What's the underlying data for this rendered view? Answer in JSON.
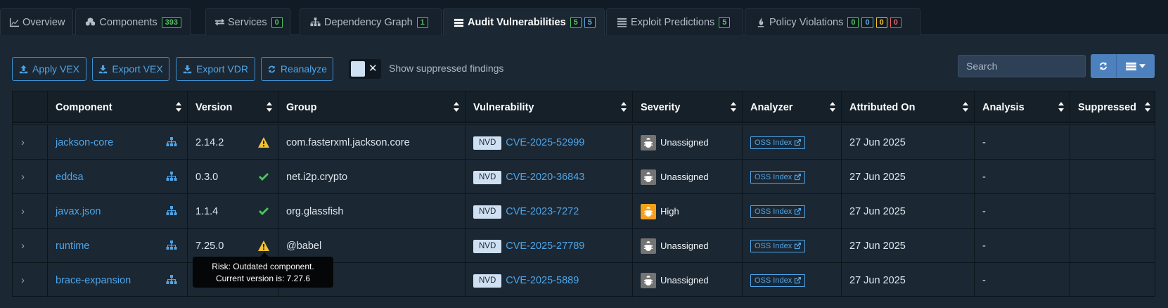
{
  "tabs": [
    {
      "label": "Overview",
      "icon": "line-chart-icon",
      "badges": []
    },
    {
      "label": "Components",
      "icon": "cubes-icon",
      "badges": [
        {
          "value": "393",
          "color": "green"
        }
      ]
    },
    {
      "label": "Services",
      "icon": "exchange-icon",
      "badges": [
        {
          "value": "0",
          "color": "green"
        }
      ]
    },
    {
      "label": "Dependency Graph",
      "icon": "sitemap-icon",
      "badges": [
        {
          "value": "1",
          "color": "green"
        }
      ]
    },
    {
      "label": "Audit Vulnerabilities",
      "icon": "tasks-icon",
      "active": true,
      "badges": [
        {
          "value": "5",
          "color": "green"
        },
        {
          "value": "5",
          "color": "blue"
        }
      ]
    },
    {
      "label": "Exploit Predictions",
      "icon": "list-icon",
      "badges": [
        {
          "value": "5",
          "color": "green"
        }
      ]
    },
    {
      "label": "Policy Violations",
      "icon": "fire-icon",
      "badges": [
        {
          "value": "0",
          "color": "green"
        },
        {
          "value": "0",
          "color": "blue"
        },
        {
          "value": "0",
          "color": "yellow"
        },
        {
          "value": "0",
          "color": "red"
        }
      ]
    }
  ],
  "toolbar": {
    "apply_vex": "Apply VEX",
    "export_vex": "Export VEX",
    "export_vdr": "Export VDR",
    "reanalyze": "Reanalyze",
    "toggle_x": "✕",
    "show_suppressed": "Show suppressed findings",
    "search_placeholder": "Search"
  },
  "columns": [
    "Component",
    "Version",
    "Group",
    "Vulnerability",
    "Severity",
    "Analyzer",
    "Attributed On",
    "Analysis",
    "Suppressed"
  ],
  "rows": [
    {
      "component": "jackson-core",
      "version": "2.14.2",
      "version_status": "warning",
      "group": "com.fasterxml.jackson.core",
      "source": "NVD",
      "vuln": "CVE-2025-52999",
      "severity": "Unassigned",
      "analyzer": "OSS Index",
      "attributed": "27 Jun 2025",
      "analysis": "-",
      "suppressed": ""
    },
    {
      "component": "eddsa",
      "version": "0.3.0",
      "version_status": "ok",
      "group": "net.i2p.crypto",
      "source": "NVD",
      "vuln": "CVE-2020-36843",
      "severity": "Unassigned",
      "analyzer": "OSS Index",
      "attributed": "27 Jun 2025",
      "analysis": "-",
      "suppressed": ""
    },
    {
      "component": "javax.json",
      "version": "1.1.4",
      "version_status": "ok",
      "group": "org.glassfish",
      "source": "NVD",
      "vuln": "CVE-2023-7272",
      "severity": "High",
      "analyzer": "OSS Index",
      "attributed": "27 Jun 2025",
      "analysis": "-",
      "suppressed": ""
    },
    {
      "component": "runtime",
      "version": "7.25.0",
      "version_status": "warning",
      "group": "@babel",
      "source": "NVD",
      "vuln": "CVE-2025-27789",
      "severity": "Unassigned",
      "analyzer": "OSS Index",
      "attributed": "27 Jun 2025",
      "analysis": "-",
      "suppressed": ""
    },
    {
      "component": "brace-expansion",
      "version": "",
      "version_status": "",
      "group": "",
      "source": "NVD",
      "vuln": "CVE-2025-5889",
      "severity": "Unassigned",
      "analyzer": "OSS Index",
      "attributed": "27 Jun 2025",
      "analysis": "-",
      "suppressed": ""
    }
  ],
  "tooltip": {
    "line1": "Risk: Outdated component.",
    "line2": "Current version is: 7.27.6"
  },
  "colors": {
    "severity_unassigned": "#737373",
    "severity_high": "#f5a01a",
    "warning": "#f1c232",
    "ok": "#4fc35e",
    "link": "#4ea5e8"
  }
}
